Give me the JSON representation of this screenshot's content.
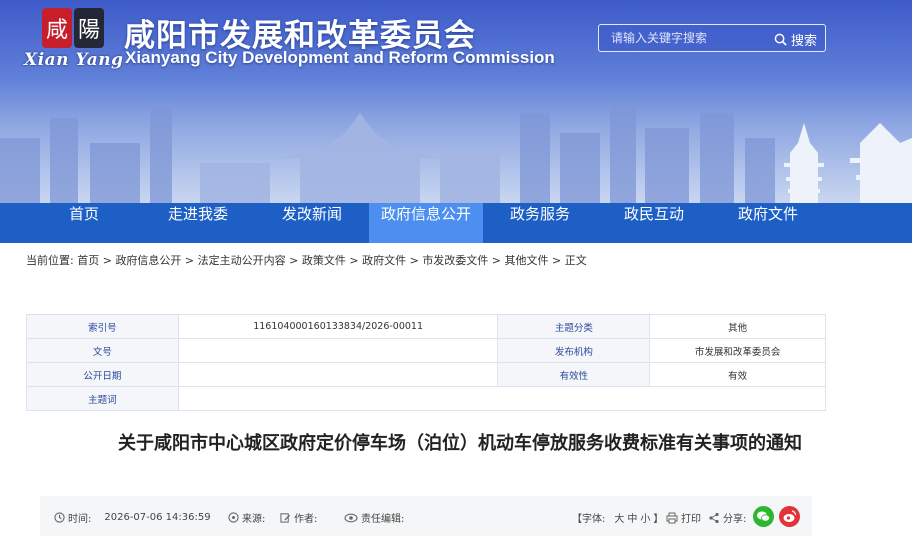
{
  "header": {
    "logo_script": "Xian Yang",
    "title_cn": "咸阳市发展和改革委员会",
    "title_en": "Xianyang City Development and Reform Commission",
    "search_placeholder": "请输入关键字搜索",
    "search_button": "搜索"
  },
  "nav": {
    "items": [
      {
        "label": "首页"
      },
      {
        "label": "走进我委"
      },
      {
        "label": "发改新闻"
      },
      {
        "label": "政府信息公开"
      },
      {
        "label": "政务服务"
      },
      {
        "label": "政民互动"
      },
      {
        "label": "政府文件"
      }
    ],
    "active_index": 3
  },
  "breadcrumb": {
    "prefix": "当前位置:",
    "items": [
      "首页",
      "政府信息公开",
      "法定主动公开内容",
      "政策文件",
      "政府文件",
      "市发改委文件",
      "其他文件",
      "正文"
    ],
    "separator": " > "
  },
  "meta": {
    "index_label": "索引号",
    "index_value": "11610400016013383​4/2026-00011",
    "topic_label": "主题分类",
    "topic_value": "其他",
    "doc_no_label": "文号",
    "doc_no_value": "",
    "publisher_label": "发布机构",
    "publisher_value": "市发展和改革委员会",
    "date_label": "公开日期",
    "date_value": "",
    "validity_label": "有效性",
    "validity_value": "有效",
    "keywords_label": "主题词",
    "keywords_value": ""
  },
  "article": {
    "title": "关于咸阳市中心城区政府定价停车场（泊位）机动车停放服务收费标准有关事项的通知"
  },
  "infobar": {
    "time_label": "时间:",
    "time_value": "2026-07-06 14:36:59",
    "source_label": "来源:",
    "author_label": "作者:",
    "editor_label": "责任编辑:",
    "font_label": "【字体:",
    "font_large": "大",
    "font_medium": "中",
    "font_small": "小",
    "font_close": "】",
    "print_label": "打印",
    "share_label": "分享:"
  },
  "colors": {
    "nav_bg": "#1e5fc6",
    "nav_active": "#4c8ff0",
    "wechat": "#2fb62f",
    "weibo": "#e0333a"
  }
}
